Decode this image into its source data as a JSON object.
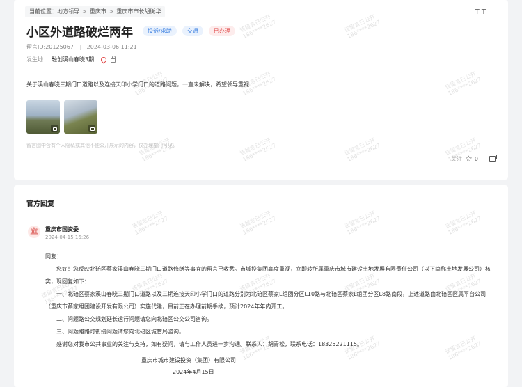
{
  "breadcrumb": {
    "label": "当前位置：",
    "items": [
      "地方领导",
      "重庆市",
      "重庆市市长胡衡华"
    ]
  },
  "font_toggle": "T T",
  "title": "小区外道路破烂两年",
  "tags": {
    "type": "投诉/求助",
    "domain": "交通",
    "status": "已办理"
  },
  "meta": {
    "message_id": "留言ID:20125067",
    "datetime": "2024-03-06 11:21"
  },
  "location": {
    "label": "发生地",
    "value": "融创溪山春晓3期"
  },
  "content": "关于溪山春晓三期门口道路以及连接天印小学门口的道路问题，一直未解决，希望领导重视",
  "images": [
    {
      "alt": "道路照片1"
    },
    {
      "alt": "道路照片2"
    }
  ],
  "disclaimer": "留言图中含有个人隐私或其他不便公开展示的内容，仅办理部门可见。",
  "actions": {
    "follow_label": "关注",
    "follow_count": "0",
    "icons": [
      "star-icon",
      "share-icon"
    ]
  },
  "reply": {
    "header": "官方回复",
    "org": "重庆市国资委",
    "time": "2024-04-15 16:26",
    "greeting": "网友：",
    "para1": "您好！您反映北碚区蔡家溪山春晓三期门口道路修缮等事宜的留言已收悉。市域投集团高度重视，立即转所属重庆市城市建设土地发展有限责任公司（以下简称土地发展公司）核实，现回复如下：",
    "para2": "一、北碚区蔡家溪山春晓三期门口道路以及三期连接天印小学门口的道路分别为北碚区蔡家L组团分区L10路与北碚区蔡家L组团分区L8路南段，上述道路由北碚区区属平台公司（重庆市蔡家组团建设开发有限公司）实施代建，目前正在办理前期手续，预计2024年年内开工。",
    "para3": "二、问题路公交规划延长运行问题请您向北碚区公交公司咨询。",
    "para4": "三、问题路路灯衔接问题请您向北碚区城管局咨询。",
    "para5": "感谢您对我市公共事业的关注与支持，如有疑问，请与工作人员进一步沟通。联系人：胡青松，联系电话：18325221115。",
    "sign_org": "重庆市城市建设投资（集团）有限公司",
    "sign_date": "2024年4月15日"
  },
  "watermark": {
    "line1": "该留言已公开",
    "line2": "186****2627"
  }
}
